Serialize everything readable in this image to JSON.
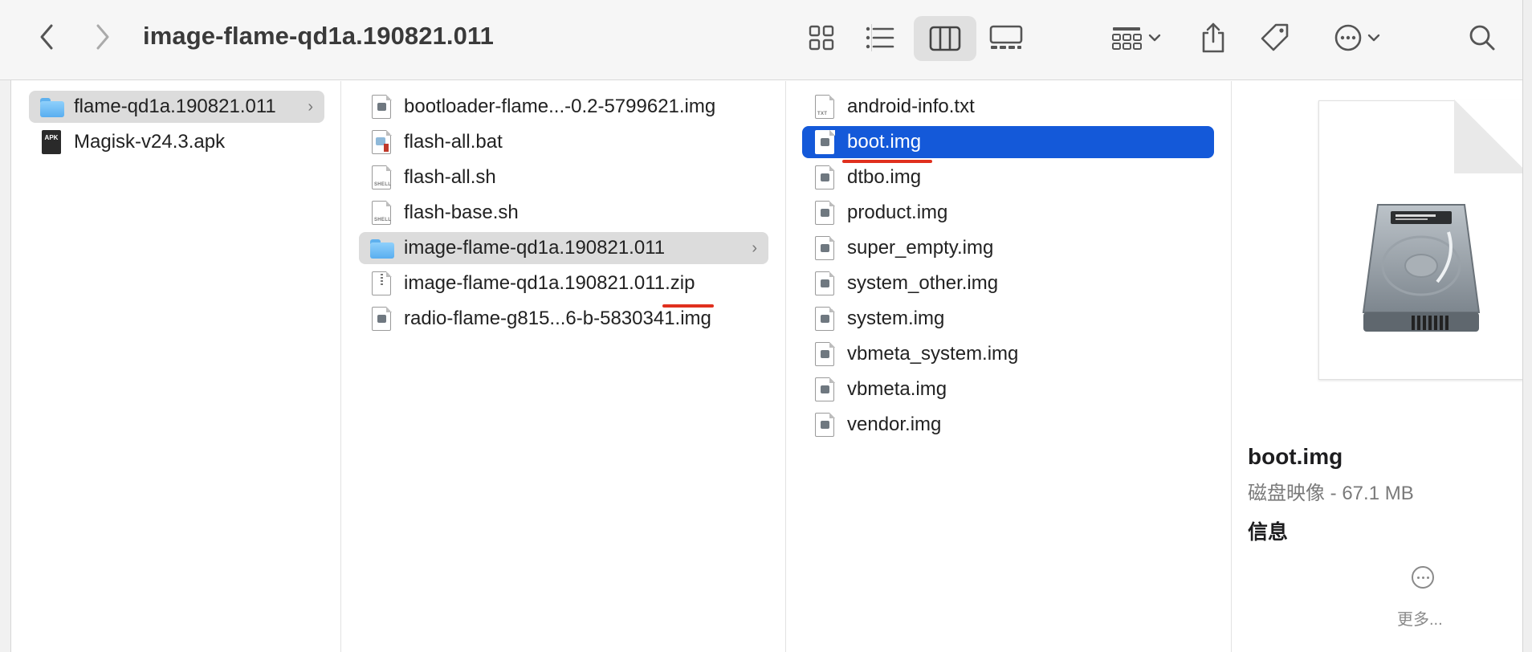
{
  "toolbar": {
    "title": "image-flame-qd1a.190821.011",
    "buttons": [
      "back",
      "forward",
      "icon-view",
      "list-view",
      "column-view",
      "gallery-view",
      "group",
      "share",
      "tags",
      "more-actions",
      "search"
    ]
  },
  "sidebar_column": {
    "items": [
      {
        "label": "flame-qd1a.190821.011",
        "kind": "folder",
        "selected": true
      },
      {
        "label": "Magisk-v24.3.apk",
        "kind": "apk",
        "icon_text": "APK"
      }
    ]
  },
  "middle_column": {
    "items": [
      {
        "label": "bootloader-flame...-0.2-5799621.img",
        "kind": "img"
      },
      {
        "label": "flash-all.bat",
        "kind": "bat"
      },
      {
        "label": "flash-all.sh",
        "kind": "shell",
        "icon_text": "SHELL"
      },
      {
        "label": "flash-base.sh",
        "kind": "shell",
        "icon_text": "SHELL"
      },
      {
        "label": "image-flame-qd1a.190821.011",
        "kind": "folder",
        "selected": true
      },
      {
        "label": "image-flame-qd1a.190821.011.zip",
        "kind": "zip"
      },
      {
        "label": "radio-flame-g815...6-b-5830341.img",
        "kind": "img"
      }
    ]
  },
  "right_column": {
    "items": [
      {
        "label": "android-info.txt",
        "kind": "txt",
        "icon_text": "TXT"
      },
      {
        "label": "boot.img",
        "kind": "img",
        "active": true
      },
      {
        "label": "dtbo.img",
        "kind": "img"
      },
      {
        "label": "product.img",
        "kind": "img"
      },
      {
        "label": "super_empty.img",
        "kind": "img"
      },
      {
        "label": "system_other.img",
        "kind": "img"
      },
      {
        "label": "system.img",
        "kind": "img"
      },
      {
        "label": "vbmeta_system.img",
        "kind": "img"
      },
      {
        "label": "vbmeta.img",
        "kind": "img"
      },
      {
        "label": "vendor.img",
        "kind": "img"
      }
    ]
  },
  "preview": {
    "name": "boot.img",
    "meta": "磁盘映像 - 67.1 MB",
    "info_heading": "信息",
    "more_label": "更多..."
  },
  "colors": {
    "selection_blue": "#1459d9",
    "selection_grey": "#dcdcdc",
    "annotation_red": "#e0301e"
  }
}
